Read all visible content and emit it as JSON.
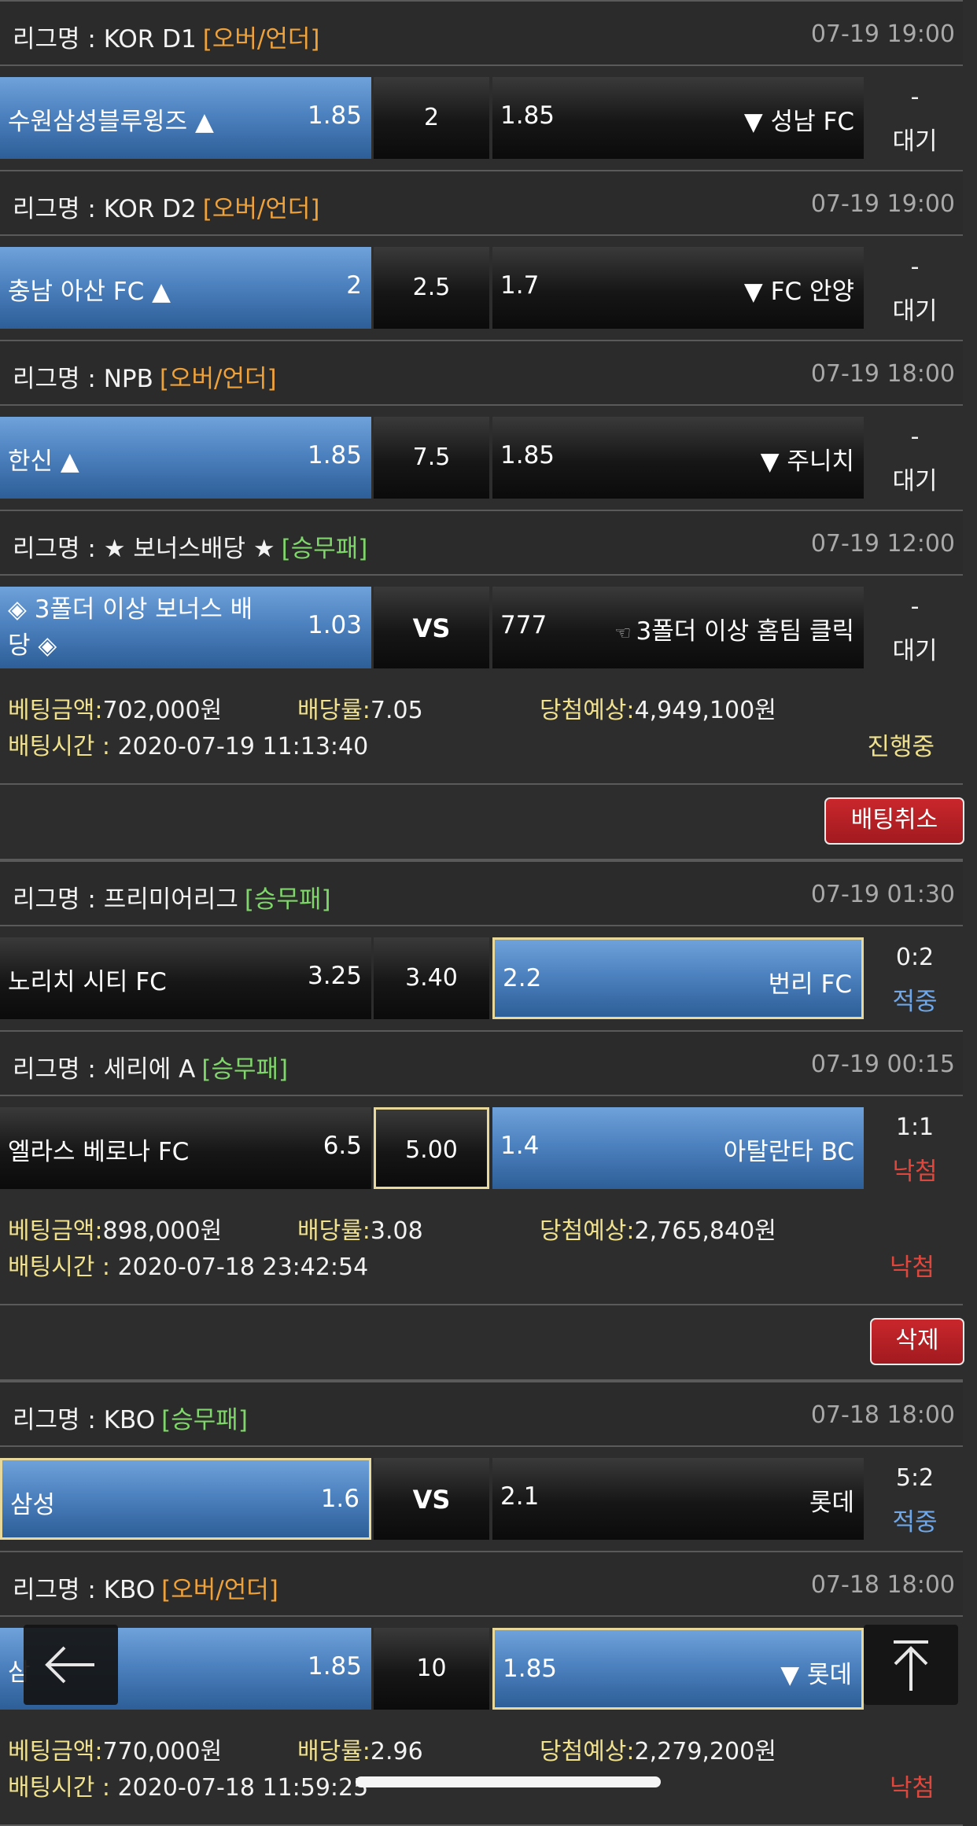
{
  "bets": [
    {
      "groups": [
        {
          "league_prefix": "리그명 : ",
          "league": "KOR D1",
          "type_label": "[오버/언더]",
          "type": "ou",
          "time": "07-19 19:00",
          "home_name": "수원삼성블루윙즈 ▲",
          "home_odds": "1.85",
          "mid": "2",
          "away_odds": "1.85",
          "away_name": "▼ 성남 FC",
          "result_score": "-",
          "result_status": "대기",
          "status_class": "wait",
          "selected": "home"
        },
        {
          "league_prefix": "리그명 : ",
          "league": "KOR D2",
          "type_label": "[오버/언더]",
          "type": "ou",
          "time": "07-19 19:00",
          "home_name": "충남 아산 FC ▲",
          "home_odds": "2",
          "mid": "2.5",
          "away_odds": "1.7",
          "away_name": "▼ FC 안양",
          "result_score": "-",
          "result_status": "대기",
          "status_class": "wait",
          "selected": "home"
        },
        {
          "league_prefix": "리그명 : ",
          "league": "NPB",
          "type_label": "[오버/언더]",
          "type": "ou",
          "time": "07-19 18:00",
          "home_name": "한신 ▲",
          "home_odds": "1.85",
          "mid": "7.5",
          "away_odds": "1.85",
          "away_name": "▼ 주니치",
          "result_score": "-",
          "result_status": "대기",
          "status_class": "wait",
          "selected": "home"
        },
        {
          "league_prefix": "리그명 : ",
          "league": "★ 보너스배당 ★",
          "type_label": "[승무패]",
          "type": "wdl",
          "time": "07-19 12:00",
          "home_name": "◈ 3폴더 이상 보너스 배당 ◈",
          "home_odds": "1.03",
          "mid": "VS",
          "away_odds": "777",
          "away_hand": "☜",
          "away_name": "3폴더 이상 홈팀 클릭",
          "result_score": "-",
          "result_status": "대기",
          "status_class": "wait",
          "selected": "home"
        }
      ],
      "summary": {
        "amount_label": "베팅금액:",
        "amount": "702,000원",
        "rate_label": "배당률:",
        "rate": "7.05",
        "expected_label": "당첨예상:",
        "expected": "4,949,100원",
        "time_label": "배팅시간 :",
        "time": "2020-07-19 11:13:40",
        "status": "진행중",
        "status_class": "prog"
      },
      "action": "배팅취소"
    },
    {
      "groups": [
        {
          "league_prefix": "리그명 : ",
          "league": "프리미어리그",
          "type_label": "[승무패]",
          "type": "wdl",
          "time": "07-19 01:30",
          "home_name": "노리치 시티 FC",
          "home_odds": "3.25",
          "mid": "3.40",
          "away_odds": "2.2",
          "away_name": "번리 FC",
          "result_score": "0:2",
          "result_status": "적중",
          "status_class": "hit",
          "selected": "away"
        },
        {
          "league_prefix": "리그명 : ",
          "league": "세리에 A",
          "type_label": "[승무패]",
          "type": "wdl",
          "time": "07-19 00:15",
          "home_name": "엘라스 베로나 FC",
          "home_odds": "6.5",
          "mid": "5.00",
          "away_odds": "1.4",
          "away_name": "아탈란타 BC",
          "result_score": "1:1",
          "result_status": "낙첨",
          "status_class": "miss",
          "selected": "mid",
          "winner": "away"
        }
      ],
      "summary": {
        "amount_label": "베팅금액:",
        "amount": "898,000원",
        "rate_label": "배당률:",
        "rate": "3.08",
        "expected_label": "당첨예상:",
        "expected": "2,765,840원",
        "time_label": "배팅시간 :",
        "time": "2020-07-18 23:42:54",
        "status": "낙첨",
        "status_class": "miss"
      },
      "action": "삭제"
    },
    {
      "groups": [
        {
          "league_prefix": "리그명 : ",
          "league": "KBO",
          "type_label": "[승무패]",
          "type": "wdl",
          "time": "07-18 18:00",
          "home_name": "삼성",
          "home_odds": "1.6",
          "mid": "VS",
          "away_odds": "2.1",
          "away_name": "롯데",
          "result_score": "5:2",
          "result_status": "적중",
          "status_class": "hit",
          "selected": "home"
        },
        {
          "league_prefix": "리그명 : ",
          "league": "KBO",
          "type_label": "[오버/언더]",
          "type": "ou",
          "time": "07-18 18:00",
          "home_name": "삼",
          "home_odds": "1.85",
          "mid": "10",
          "away_odds": "1.85",
          "away_name": "▼ 롯데",
          "result_score": "",
          "result_status": "",
          "status_class": "wait",
          "selected": "away",
          "winner": "home"
        }
      ],
      "summary": {
        "amount_label": "베팅금액:",
        "amount": "770,000원",
        "rate_label": "배당률:",
        "rate": "2.96",
        "expected_label": "당첨예상:",
        "expected": "2,279,200원",
        "time_label": "배팅시간 :",
        "time": "2020-07-18 11:59:25",
        "status": "낙첨",
        "status_class": "miss"
      },
      "action": ""
    }
  ],
  "nav": {
    "back_icon": "arrow-left-icon",
    "top_icon": "arrow-up-to-top-icon"
  },
  "colors": {
    "background": "#2d2d2d",
    "selected_blue": "#4d82c0",
    "over_under_tag": "#f0a23a",
    "win_draw_loss_tag": "#7fd66a",
    "label_yellow": "#f0e18f",
    "hit_blue": "#6fa7e8",
    "miss_red": "#e0473c",
    "button_red": "#b52025"
  }
}
